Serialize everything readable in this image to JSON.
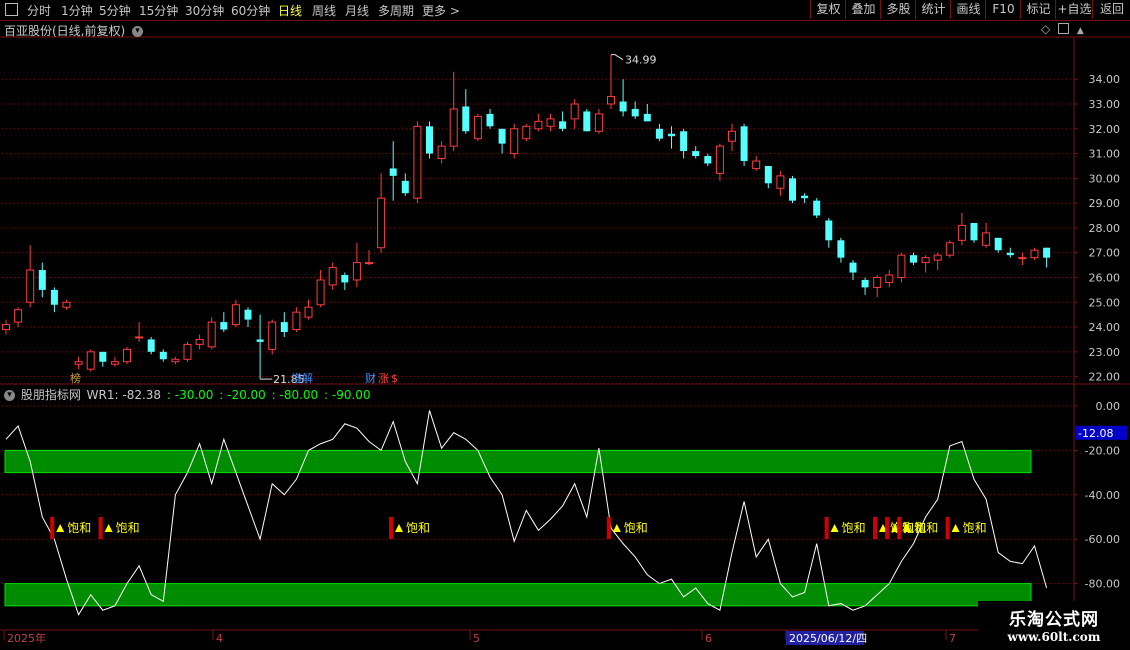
{
  "toolbar": {
    "periods": [
      "分时",
      "1分钟",
      "5分钟",
      "15分钟",
      "30分钟",
      "60分钟",
      "日线",
      "周线",
      "月线",
      "多周期",
      "更多 >"
    ],
    "active_period": "日线",
    "buttons": [
      "复权",
      "叠加",
      "多股",
      "统计",
      "画线",
      "F10",
      "标记",
      "+自选",
      "返回"
    ]
  },
  "stock_title": "百亚股份(日线,前复权)",
  "indicator": {
    "name": "股朋指标网",
    "wr_label": "WR1: -82.38",
    "lines": [
      ": -30.00",
      ": -20.00",
      ": -80.00",
      ": -90.00"
    ],
    "line_colors": [
      "#00ff00",
      "#00ff00",
      "#00ff00",
      "#00ff00"
    ]
  },
  "colors": {
    "up": "#ff3c3c",
    "down": "#54ffff",
    "grid": "#7a0f0f",
    "band": "#008c00"
  },
  "annotations": {
    "high_label": "34.99",
    "low_label": "21.85",
    "events": [
      "榜",
      "增解",
      "财",
      "涨",
      "$"
    ]
  },
  "x_axis": {
    "labels": [
      "2025年",
      "4",
      "5",
      "6",
      "2025/06/12/四",
      "7"
    ]
  },
  "watermark": {
    "line1": "乐淘公式网",
    "line2": "www.60lt.com"
  },
  "chart_data": [
    {
      "type": "candlestick",
      "title": "百亚股份(日线,前复权)",
      "y_ticks": [
        22,
        23,
        24,
        25,
        26,
        27,
        28,
        29,
        30,
        31,
        32,
        33,
        34
      ],
      "ylim": [
        21.5,
        35.3
      ],
      "candles": [
        {
          "o": 23.9,
          "h": 24.3,
          "l": 23.7,
          "c": 24.1
        },
        {
          "o": 24.2,
          "h": 24.8,
          "l": 24.0,
          "c": 24.7
        },
        {
          "o": 25.0,
          "h": 27.3,
          "l": 24.8,
          "c": 26.3
        },
        {
          "o": 26.3,
          "h": 26.6,
          "l": 25.2,
          "c": 25.5
        },
        {
          "o": 25.5,
          "h": 25.6,
          "l": 24.6,
          "c": 24.9
        },
        {
          "o": 24.8,
          "h": 25.1,
          "l": 24.7,
          "c": 25.0
        },
        {
          "o": 22.5,
          "h": 22.8,
          "l": 22.3,
          "c": 22.6
        },
        {
          "o": 22.3,
          "h": 23.1,
          "l": 22.2,
          "c": 23.0
        },
        {
          "o": 23.0,
          "h": 23.0,
          "l": 22.4,
          "c": 22.6
        },
        {
          "o": 22.5,
          "h": 22.8,
          "l": 22.4,
          "c": 22.6
        },
        {
          "o": 22.6,
          "h": 23.2,
          "l": 22.5,
          "c": 23.1
        },
        {
          "o": 23.6,
          "h": 24.2,
          "l": 23.4,
          "c": 23.6
        },
        {
          "o": 23.5,
          "h": 23.6,
          "l": 22.9,
          "c": 23.0
        },
        {
          "o": 23.0,
          "h": 23.1,
          "l": 22.6,
          "c": 22.7
        },
        {
          "o": 22.6,
          "h": 22.8,
          "l": 22.5,
          "c": 22.7
        },
        {
          "o": 22.7,
          "h": 23.4,
          "l": 22.6,
          "c": 23.3
        },
        {
          "o": 23.3,
          "h": 23.7,
          "l": 23.1,
          "c": 23.5
        },
        {
          "o": 23.2,
          "h": 24.4,
          "l": 23.1,
          "c": 24.2
        },
        {
          "o": 24.2,
          "h": 24.6,
          "l": 23.8,
          "c": 23.9
        },
        {
          "o": 24.1,
          "h": 25.1,
          "l": 24.0,
          "c": 24.9
        },
        {
          "o": 24.7,
          "h": 24.8,
          "l": 24.0,
          "c": 24.3
        },
        {
          "o": 23.5,
          "h": 24.5,
          "l": 21.9,
          "c": 23.4
        },
        {
          "o": 23.1,
          "h": 24.3,
          "l": 22.9,
          "c": 24.2
        },
        {
          "o": 24.2,
          "h": 24.6,
          "l": 23.6,
          "c": 23.8
        },
        {
          "o": 23.9,
          "h": 24.8,
          "l": 23.8,
          "c": 24.6
        },
        {
          "o": 24.4,
          "h": 25.1,
          "l": 24.3,
          "c": 24.8
        },
        {
          "o": 24.9,
          "h": 26.3,
          "l": 24.8,
          "c": 25.9
        },
        {
          "o": 25.7,
          "h": 26.6,
          "l": 25.5,
          "c": 26.4
        },
        {
          "o": 26.1,
          "h": 26.2,
          "l": 25.5,
          "c": 25.8
        },
        {
          "o": 25.9,
          "h": 27.4,
          "l": 25.6,
          "c": 26.6
        },
        {
          "o": 26.6,
          "h": 27.1,
          "l": 26.5,
          "c": 26.6
        },
        {
          "o": 27.2,
          "h": 30.2,
          "l": 27.0,
          "c": 29.2
        },
        {
          "o": 30.4,
          "h": 31.5,
          "l": 29.1,
          "c": 30.1
        },
        {
          "o": 29.9,
          "h": 30.2,
          "l": 29.3,
          "c": 29.4
        },
        {
          "o": 29.2,
          "h": 32.3,
          "l": 29.0,
          "c": 32.1
        },
        {
          "o": 32.1,
          "h": 32.3,
          "l": 30.8,
          "c": 31.0
        },
        {
          "o": 30.8,
          "h": 31.5,
          "l": 30.6,
          "c": 31.3
        },
        {
          "o": 31.3,
          "h": 34.3,
          "l": 31.1,
          "c": 32.8
        },
        {
          "o": 32.9,
          "h": 33.6,
          "l": 31.8,
          "c": 31.9
        },
        {
          "o": 31.6,
          "h": 32.6,
          "l": 31.5,
          "c": 32.5
        },
        {
          "o": 32.6,
          "h": 32.8,
          "l": 32.0,
          "c": 32.1
        },
        {
          "o": 32.0,
          "h": 32.0,
          "l": 31.0,
          "c": 31.4
        },
        {
          "o": 31.0,
          "h": 32.2,
          "l": 30.8,
          "c": 32.0
        },
        {
          "o": 31.6,
          "h": 32.2,
          "l": 31.5,
          "c": 32.1
        },
        {
          "o": 32.0,
          "h": 32.6,
          "l": 31.9,
          "c": 32.3
        },
        {
          "o": 32.1,
          "h": 32.6,
          "l": 31.9,
          "c": 32.4
        },
        {
          "o": 32.3,
          "h": 32.7,
          "l": 31.9,
          "c": 32.0
        },
        {
          "o": 32.4,
          "h": 33.2,
          "l": 32.0,
          "c": 33.0
        },
        {
          "o": 32.7,
          "h": 32.8,
          "l": 31.9,
          "c": 31.9
        },
        {
          "o": 31.9,
          "h": 32.8,
          "l": 31.8,
          "c": 32.6
        },
        {
          "o": 33.0,
          "h": 34.99,
          "l": 32.8,
          "c": 33.3
        },
        {
          "o": 33.1,
          "h": 34.0,
          "l": 32.5,
          "c": 32.7
        },
        {
          "o": 32.8,
          "h": 33.1,
          "l": 32.4,
          "c": 32.5
        },
        {
          "o": 32.6,
          "h": 33.0,
          "l": 32.3,
          "c": 32.3
        },
        {
          "o": 32.0,
          "h": 32.2,
          "l": 31.5,
          "c": 31.6
        },
        {
          "o": 31.8,
          "h": 32.1,
          "l": 31.2,
          "c": 31.7
        },
        {
          "o": 31.9,
          "h": 32.0,
          "l": 30.8,
          "c": 31.1
        },
        {
          "o": 31.1,
          "h": 31.3,
          "l": 30.8,
          "c": 30.9
        },
        {
          "o": 30.9,
          "h": 31.0,
          "l": 30.5,
          "c": 30.6
        },
        {
          "o": 30.2,
          "h": 31.4,
          "l": 29.9,
          "c": 31.3
        },
        {
          "o": 31.5,
          "h": 32.2,
          "l": 31.1,
          "c": 31.9
        },
        {
          "o": 32.1,
          "h": 32.2,
          "l": 30.5,
          "c": 30.7
        },
        {
          "o": 30.4,
          "h": 30.9,
          "l": 30.3,
          "c": 30.7
        },
        {
          "o": 30.5,
          "h": 30.5,
          "l": 29.6,
          "c": 29.8
        },
        {
          "o": 29.6,
          "h": 30.3,
          "l": 29.3,
          "c": 30.1
        },
        {
          "o": 30.0,
          "h": 30.1,
          "l": 29.0,
          "c": 29.1
        },
        {
          "o": 29.3,
          "h": 29.4,
          "l": 29.0,
          "c": 29.2
        },
        {
          "o": 29.1,
          "h": 29.2,
          "l": 28.4,
          "c": 28.5
        },
        {
          "o": 28.3,
          "h": 28.4,
          "l": 27.2,
          "c": 27.5
        },
        {
          "o": 27.5,
          "h": 27.6,
          "l": 26.6,
          "c": 26.8
        },
        {
          "o": 26.6,
          "h": 26.7,
          "l": 25.9,
          "c": 26.2
        },
        {
          "o": 25.9,
          "h": 26.0,
          "l": 25.3,
          "c": 25.6
        },
        {
          "o": 25.6,
          "h": 26.1,
          "l": 25.2,
          "c": 26.0
        },
        {
          "o": 25.8,
          "h": 26.3,
          "l": 25.6,
          "c": 26.1
        },
        {
          "o": 26.0,
          "h": 27.0,
          "l": 25.8,
          "c": 26.9
        },
        {
          "o": 26.9,
          "h": 27.0,
          "l": 26.5,
          "c": 26.6
        },
        {
          "o": 26.6,
          "h": 26.9,
          "l": 26.2,
          "c": 26.8
        },
        {
          "o": 26.7,
          "h": 27.0,
          "l": 26.3,
          "c": 26.9
        },
        {
          "o": 26.9,
          "h": 27.5,
          "l": 26.8,
          "c": 27.4
        },
        {
          "o": 27.5,
          "h": 28.6,
          "l": 27.3,
          "c": 28.1
        },
        {
          "o": 28.2,
          "h": 28.2,
          "l": 27.4,
          "c": 27.5
        },
        {
          "o": 27.3,
          "h": 28.2,
          "l": 27.2,
          "c": 27.8
        },
        {
          "o": 27.6,
          "h": 27.6,
          "l": 27.0,
          "c": 27.1
        },
        {
          "o": 27.0,
          "h": 27.2,
          "l": 26.8,
          "c": 26.9
        },
        {
          "o": 26.8,
          "h": 27.0,
          "l": 26.5,
          "c": 26.8
        },
        {
          "o": 26.8,
          "h": 27.2,
          "l": 26.7,
          "c": 27.1
        },
        {
          "o": 27.2,
          "h": 27.2,
          "l": 26.4,
          "c": 26.8
        }
      ]
    },
    {
      "type": "line",
      "title": "股朋指标网",
      "y_ticks": [
        0,
        -20,
        -40,
        -60,
        -80
      ],
      "ylim": [
        -100,
        0
      ],
      "current_value": -12.08,
      "bands": [
        [
          -20,
          -30
        ],
        [
          -80,
          -90
        ]
      ],
      "series": [
        {
          "values": [
            -15,
            -9,
            -25,
            -50,
            -60,
            -78,
            -94,
            -85,
            -92,
            -90,
            -80,
            -72,
            -85,
            -88,
            -40,
            -30,
            -17,
            -35,
            -15,
            -30,
            -45,
            -60,
            -35,
            -40,
            -33,
            -20,
            -17,
            -15,
            -8,
            -10,
            -16,
            -20,
            -7,
            -25,
            -35,
            -2,
            -19,
            -12,
            -15,
            -20,
            -32,
            -40,
            -61,
            -47,
            -56,
            -51,
            -45,
            -35,
            -50,
            -19,
            -55,
            -62,
            -68,
            -76,
            -80,
            -78,
            -86,
            -82,
            -89,
            -92,
            -66,
            -43,
            -68,
            -60,
            -80,
            -86,
            -84,
            -62,
            -90,
            -89,
            -92,
            -90,
            -85,
            -80,
            -70,
            -62,
            -50,
            -42,
            -18,
            -16,
            -33,
            -42,
            -66,
            -70,
            -71,
            -63,
            -82
          ]
        }
      ],
      "signals": [
        {
          "index": 2,
          "label": "饱和"
        },
        {
          "index": 6,
          "label": "饱和"
        },
        {
          "index": 30,
          "label": "饱和"
        },
        {
          "index": 48,
          "label": "饱和"
        },
        {
          "index": 66,
          "label": "饱和"
        },
        {
          "index": 70,
          "label": "饱和"
        },
        {
          "index": 71,
          "label": "饱和"
        },
        {
          "index": 72,
          "label": "饱和"
        },
        {
          "index": 76,
          "label": "饱和"
        }
      ]
    }
  ]
}
